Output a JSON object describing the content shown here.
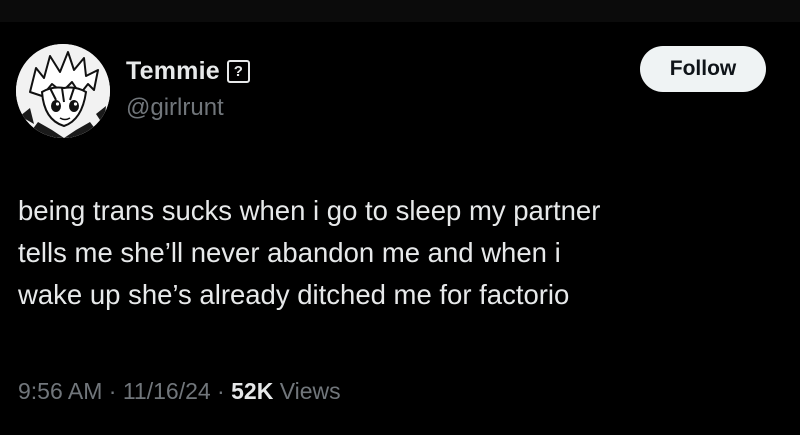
{
  "user": {
    "display_name": "Temmie",
    "badge_icon": "question-mark-box-icon",
    "badge_glyph": "?",
    "handle": "@girlrunt",
    "avatar_icon": "anime-character-avatar-icon"
  },
  "actions": {
    "follow_label": "Follow"
  },
  "tweet": {
    "lines": [
      "being trans sucks when i go to sleep my partner",
      "tells me she’ll never abandon me and when i",
      "wake up she’s already ditched me for factorio"
    ]
  },
  "meta": {
    "time": "9:56 AM",
    "separator": " · ",
    "date": "11/16/24",
    "views_count": "52K",
    "views_label": " Views"
  },
  "colors": {
    "background": "#000000",
    "text_primary": "#e7e9ea",
    "text_secondary": "#71767b",
    "button_bg": "#eff3f4",
    "button_text": "#0f1419"
  }
}
